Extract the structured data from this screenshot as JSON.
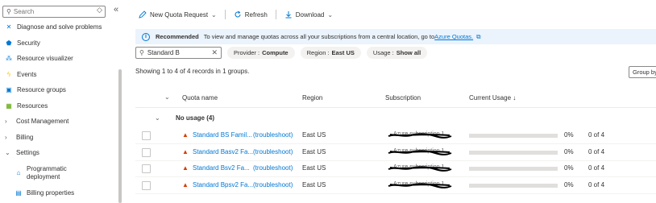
{
  "sidebar": {
    "search_placeholder": "Search",
    "collapse_glyph": "◇",
    "collapse_all_glyph": "«",
    "items": [
      {
        "label": "Diagnose and solve problems",
        "icon": "wrench-icon",
        "glyph": "✕",
        "color": "#0078d4"
      },
      {
        "label": "Security",
        "icon": "shield-icon",
        "glyph": "⬟",
        "color": "#0078d4"
      },
      {
        "label": "Resource visualizer",
        "icon": "network-icon",
        "glyph": "⁂",
        "color": "#0078d4"
      },
      {
        "label": "Events",
        "icon": "bolt-icon",
        "glyph": "ϟ",
        "color": "#f2c811"
      },
      {
        "label": "Resource groups",
        "icon": "resource-group-icon",
        "glyph": "▣",
        "color": "#0078d4"
      },
      {
        "label": "Resources",
        "icon": "grid-icon",
        "glyph": "▦",
        "color": "#57a300"
      }
    ],
    "groups": [
      {
        "label": "Cost Management",
        "chevron": "›"
      },
      {
        "label": "Billing",
        "chevron": "›"
      },
      {
        "label": "Settings",
        "chevron": "⌄"
      }
    ],
    "sub_items": [
      {
        "label": "Programmatic deployment",
        "icon": "deployment-icon",
        "glyph": "⌂",
        "color": "#0078d4"
      },
      {
        "label": "Billing properties",
        "icon": "billing-properties-icon",
        "glyph": "▤",
        "color": "#0078d4"
      }
    ]
  },
  "toolbar": {
    "new_request_label": "New Quota Request",
    "refresh_label": "Refresh",
    "download_label": "Download"
  },
  "banner": {
    "title": "Recommended",
    "text": "To view and manage quotas across all your subscriptions from a central location, go to",
    "link": "Azure Quotas."
  },
  "filters": {
    "search_value": "Standard B",
    "provider_key": "Provider :",
    "provider_value": "Compute",
    "region_key": "Region :",
    "region_value": "East US",
    "usage_key": "Usage :",
    "usage_value": "Show all"
  },
  "summary": "Showing 1 to 4 of 4 records in 1 groups.",
  "group_by_label": "Group by",
  "columns": {
    "quota_name": "Quota name",
    "region": "Region",
    "subscription": "Subscription",
    "current_usage": "Current Usage ↓"
  },
  "group": {
    "label": "No usage (4)"
  },
  "rows": [
    {
      "name": "Standard BS Famil...",
      "link": "(troubleshoot)",
      "region": "East US",
      "subscription": "Azure subscription 1",
      "usage_fraction": 0,
      "percent": "0%",
      "count": "0 of 4"
    },
    {
      "name": "Standard Basv2 Fa...",
      "link": "(troubleshoot)",
      "region": "East US",
      "subscription": "Azure subscription 1",
      "usage_fraction": 0,
      "percent": "0%",
      "count": "0 of 4"
    },
    {
      "name": "Standard Bsv2 Fa...",
      "link": "(troubleshoot)",
      "region": "East US",
      "subscription": "Azure subscription 1",
      "usage_fraction": 0,
      "percent": "0%",
      "count": "0 of 4"
    },
    {
      "name": "Standard Bpsv2 Fa...",
      "link": "(troubleshoot)",
      "region": "East US",
      "subscription": "Azure subscription 1",
      "usage_fraction": 0,
      "percent": "0%",
      "count": "0 of 4"
    }
  ]
}
